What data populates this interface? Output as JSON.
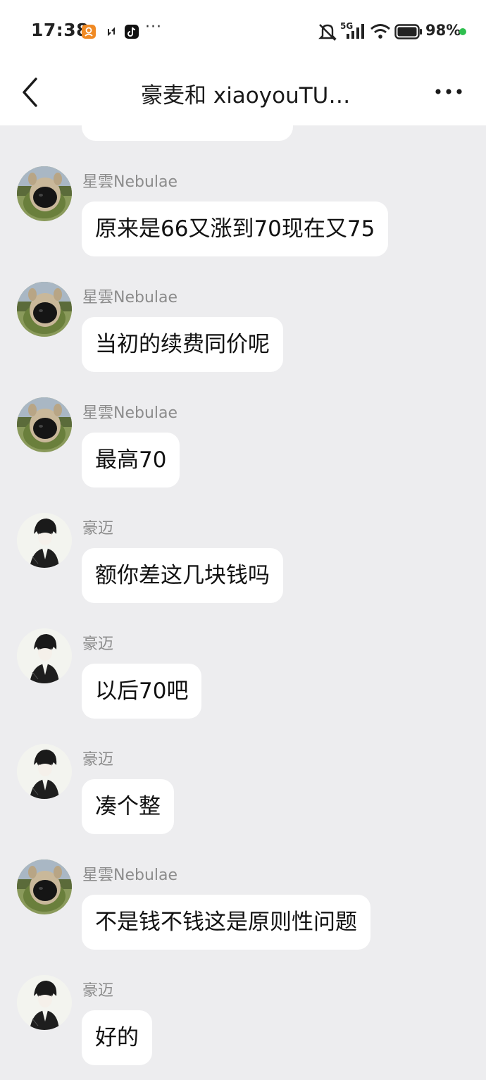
{
  "status_bar": {
    "time": "17:38",
    "network": "5G",
    "battery": "98%",
    "more_indicator": "···",
    "icons": [
      "orange-app-icon",
      "sync-icon",
      "tiktok-icon",
      "mute-icon",
      "signal-icon",
      "wifi-icon",
      "battery-icon"
    ],
    "battery_dot_color": "#2fbf4f"
  },
  "nav": {
    "title": "豪麦和 xiaoyouTU…",
    "back_icon": "chevron-left-icon",
    "more_icon": "more-dots-icon"
  },
  "colors": {
    "background": "#ededef",
    "bubble": "#ffffff",
    "sender_text": "#8c8c8c"
  },
  "messages": [
    {
      "sender": "星雲Nebulae",
      "text": "原来是66又涨到70现在又75",
      "avatar": "nebulae"
    },
    {
      "sender": "星雲Nebulae",
      "text": "当初的续费同价呢",
      "avatar": "nebulae"
    },
    {
      "sender": "星雲Nebulae",
      "text": "最高70",
      "avatar": "nebulae"
    },
    {
      "sender": "豪迈",
      "text": "额你差这几块钱吗",
      "avatar": "haomai"
    },
    {
      "sender": "豪迈",
      "text": "以后70吧",
      "avatar": "haomai"
    },
    {
      "sender": "豪迈",
      "text": "凑个整",
      "avatar": "haomai"
    },
    {
      "sender": "星雲Nebulae",
      "text": "不是钱不钱这是原则性问题",
      "avatar": "nebulae"
    },
    {
      "sender": "豪迈",
      "text": "好的",
      "avatar": "haomai"
    }
  ]
}
